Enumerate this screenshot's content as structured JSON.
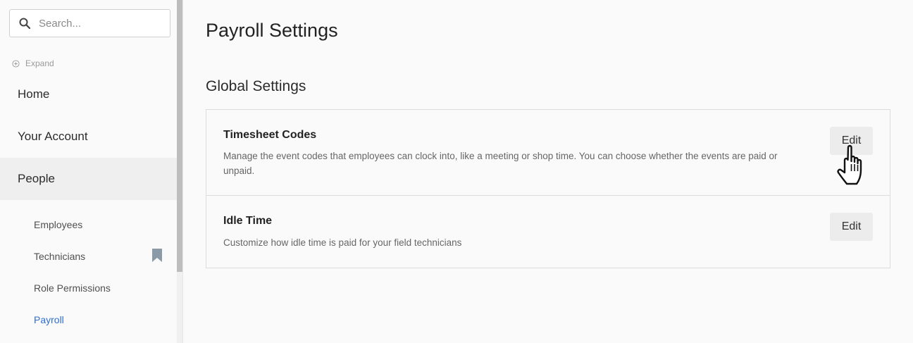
{
  "sidebar": {
    "search": {
      "placeholder": "Search..."
    },
    "expand_label": "Expand",
    "nav": [
      {
        "label": "Home"
      },
      {
        "label": "Your Account"
      },
      {
        "label": "People"
      }
    ],
    "sub_items": [
      {
        "label": "Employees"
      },
      {
        "label": "Technicians"
      },
      {
        "label": "Role Permissions"
      },
      {
        "label": "Payroll"
      }
    ]
  },
  "main": {
    "page_title": "Payroll Settings",
    "section_title": "Global Settings",
    "settings": [
      {
        "title": "Timesheet Codes",
        "description": "Manage the event codes that employees can clock into, like a meeting or shop time. You can choose whether the events are paid or unpaid.",
        "button_label": "Edit"
      },
      {
        "title": "Idle Time",
        "description": "Customize how idle time is paid for your field technicians",
        "button_label": "Edit"
      }
    ]
  },
  "colors": {
    "accent": "#2f6fd0",
    "background": "#fafafa",
    "active_nav_bg": "#efefef",
    "button_bg": "#ececec"
  },
  "icons": {
    "search": "search-icon",
    "expand": "plus-circle-icon",
    "bookmark": "bookmark-icon",
    "cursor": "hand-pointer-icon"
  }
}
